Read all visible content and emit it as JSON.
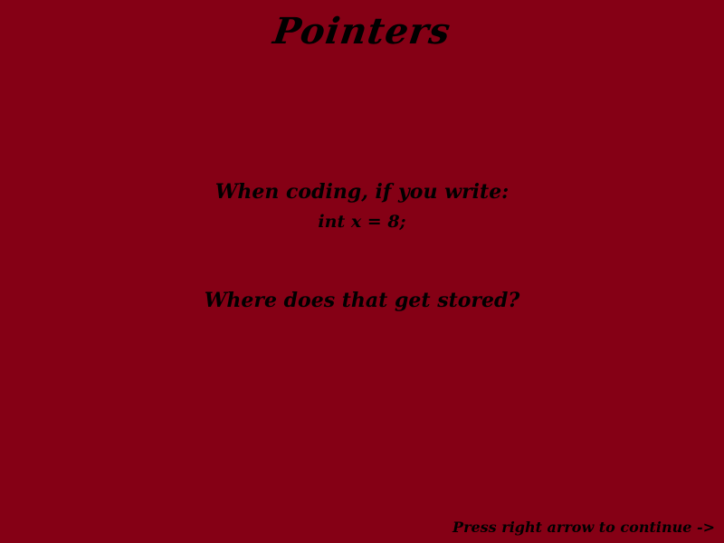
{
  "slide": {
    "title": "Pointers",
    "line1": "When coding, if you write:",
    "code": "int x = 8;",
    "question": "Where does that get stored?",
    "footer": "Press right arrow to continue ->"
  },
  "colors": {
    "background": "#850015",
    "text": "#000000"
  }
}
